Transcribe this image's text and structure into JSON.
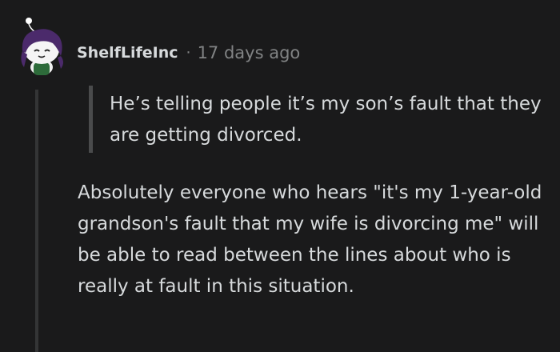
{
  "comment": {
    "author": "ShelfLifeInc",
    "separator": "·",
    "timestamp": "17 days ago",
    "quote": "He’s telling people it’s my son’s fault that they are getting divorced.",
    "body": "Absolutely everyone who hears \"it's my 1-year-old grandson's fault that my wife is divorcing me\" will be able to read between the lines about who is really at fault in this situation."
  },
  "colors": {
    "background": "#1a1a1b",
    "text": "#d7dadc",
    "meta": "#818384",
    "thread_line": "#343536",
    "quote_bar": "#4a4b4c",
    "avatar_hair": "#4b2a6b"
  },
  "icons": {
    "avatar": "snoo-avatar-purple-hair"
  }
}
